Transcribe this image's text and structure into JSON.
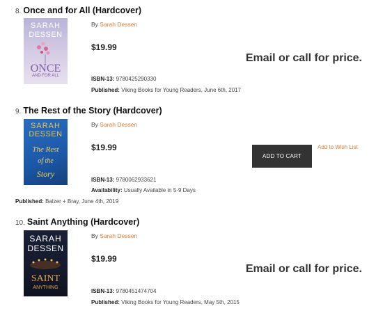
{
  "books": [
    {
      "number": "8.",
      "title": "Once and for All (Hardcover)",
      "by_prefix": "By",
      "author": "Sarah Dessen",
      "price": "$19.99",
      "price_note": "Email or call for price.",
      "isbn_label": "ISBN-13:",
      "isbn": "9780425290330",
      "published_label": "Published:",
      "published": "Viking Books for Young Readers, June 6th, 2017",
      "cover": {
        "author_top": "SARAH",
        "author_bottom": "DESSEN",
        "title_line1": "ONCE",
        "title_line2": "AND FOR ALL",
        "bg": "#cbc4de",
        "accent": "#d9668d"
      }
    },
    {
      "number": "9.",
      "title": "The Rest of the Story (Hardcover)",
      "by_prefix": "By",
      "author": "Sarah Dessen",
      "price": "$19.99",
      "add_to_cart": "ADD TO CART",
      "wishlist": "Add to Wish List",
      "isbn_label": "ISBN-13:",
      "isbn": "9780062933621",
      "availability_label": "Availability:",
      "availability": "Usually Available in 5-9 Days",
      "published_label": "Published:",
      "published": "Balzer + Bray, June 4th, 2019",
      "cover": {
        "author_top": "SARAH",
        "author_bottom": "DESSEN",
        "title_line1": "The Rest",
        "title_line2": "of the",
        "title_line3": "Story",
        "bg": "#1c58a8",
        "accent": "#e8c44a"
      }
    },
    {
      "number": "10.",
      "title": "Saint Anything (Hardcover)",
      "by_prefix": "By",
      "author": "Sarah Dessen",
      "price": "$19.99",
      "price_note": "Email or call for price.",
      "isbn_label": "ISBN-13:",
      "isbn": "9780451474704",
      "published_label": "Published:",
      "published": "Viking Books for Young Readers, May 5th, 2015",
      "cover": {
        "author_top": "SARAH",
        "author_bottom": "DESSEN",
        "title_line1": "SAINT",
        "title_line2": "ANYTHING",
        "bg": "#151a2b",
        "accent": "#e2a548"
      }
    }
  ]
}
